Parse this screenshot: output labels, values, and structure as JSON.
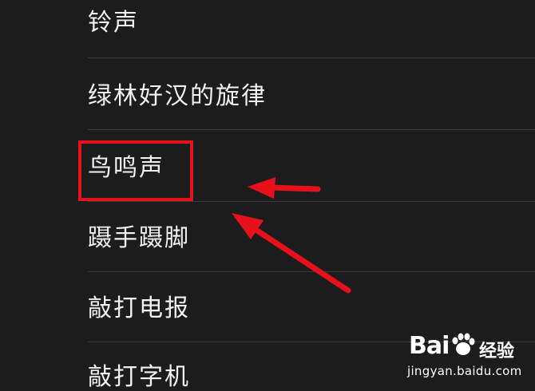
{
  "ringtones": {
    "items": [
      {
        "label": "铃声"
      },
      {
        "label": "绿林好汉的旋律"
      },
      {
        "label": "鸟鸣声"
      },
      {
        "label": "蹑手蹑脚"
      },
      {
        "label": "敲打电报"
      },
      {
        "label": "敲打字机"
      }
    ]
  },
  "annotation": {
    "color": "#e8101b"
  },
  "watermark": {
    "logo": "Bai",
    "brand": "经验",
    "url": "jingyan.baidu.com"
  }
}
